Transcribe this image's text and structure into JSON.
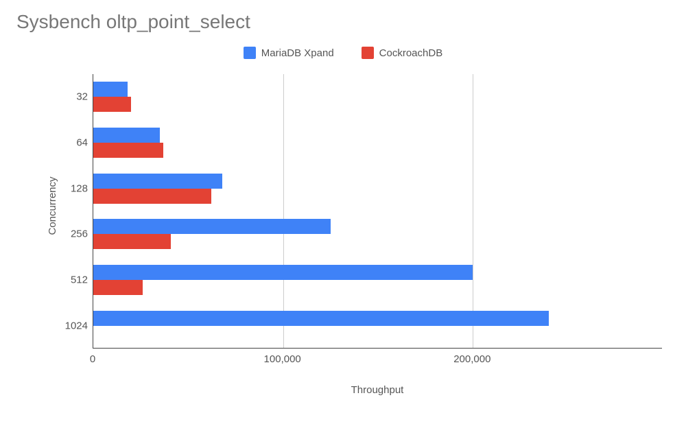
{
  "chart_data": {
    "type": "bar",
    "orientation": "horizontal",
    "title": "Sysbench oltp_point_select",
    "xlabel": "Throughput",
    "ylabel": "Concurrency",
    "xlim": [
      0,
      300000
    ],
    "x_ticks": [
      0,
      100000,
      200000
    ],
    "x_tick_labels": [
      "0",
      "100,000",
      "200,000"
    ],
    "categories": [
      "32",
      "64",
      "128",
      "256",
      "512",
      "1024"
    ],
    "series": [
      {
        "name": "MariaDB Xpand",
        "color": "#3f82f7",
        "values": [
          18000,
          35000,
          68000,
          125000,
          200000,
          240000
        ]
      },
      {
        "name": "CockroachDB",
        "color": "#e34234",
        "values": [
          20000,
          37000,
          62000,
          41000,
          26000,
          0
        ]
      }
    ],
    "grid_x": [
      100000,
      200000
    ]
  }
}
